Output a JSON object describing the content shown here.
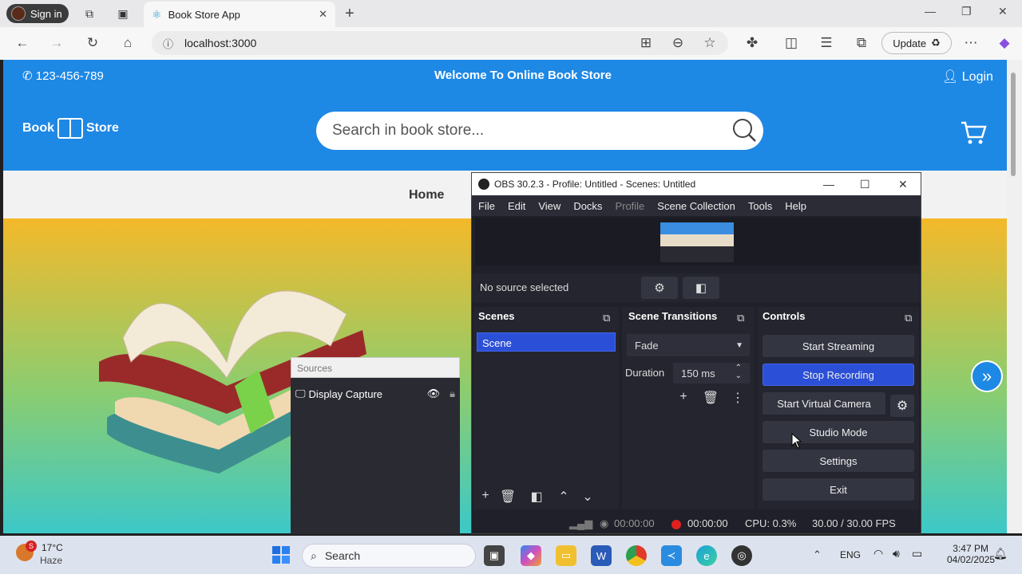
{
  "browser": {
    "signin_label": "Sign in",
    "tab_title": "Book Store App",
    "url": "localhost:3000",
    "update_label": "Update"
  },
  "site": {
    "phone": "123-456-789",
    "welcome": "Welcome To Online Book Store",
    "login": "Login",
    "logo_left": "Book",
    "logo_right": "Store",
    "search_placeholder": "Search in book store...",
    "nav_home": "Home",
    "accent": "#1e88e5"
  },
  "sources_panel": {
    "title": "Sources",
    "item": "Display Capture"
  },
  "obs": {
    "title": "OBS 30.2.3 - Profile: Untitled - Scenes: Untitled",
    "menu": [
      "File",
      "Edit",
      "View",
      "Docks",
      "Profile",
      "Scene Collection",
      "Tools",
      "Help"
    ],
    "no_source": "No source selected",
    "scenes_title": "Scenes",
    "scene_item": "Scene",
    "transitions_title": "Scene Transitions",
    "transition": "Fade",
    "duration_label": "Duration",
    "duration_value": "150 ms",
    "controls_title": "Controls",
    "controls": [
      "Start Streaming",
      "Stop Recording",
      "Start Virtual Camera",
      "Studio Mode",
      "Settings",
      "Exit"
    ],
    "status": {
      "stream_time": "00:00:00",
      "rec_time": "00:00:00",
      "cpu": "CPU: 0.3%",
      "fps": "30.00 / 30.00 FPS"
    }
  },
  "taskbar": {
    "temp": "17°C",
    "weather": "Haze",
    "search": "Search",
    "lang": "ENG",
    "time": "3:47 PM",
    "date": "04/02/2025",
    "badge": "S"
  }
}
